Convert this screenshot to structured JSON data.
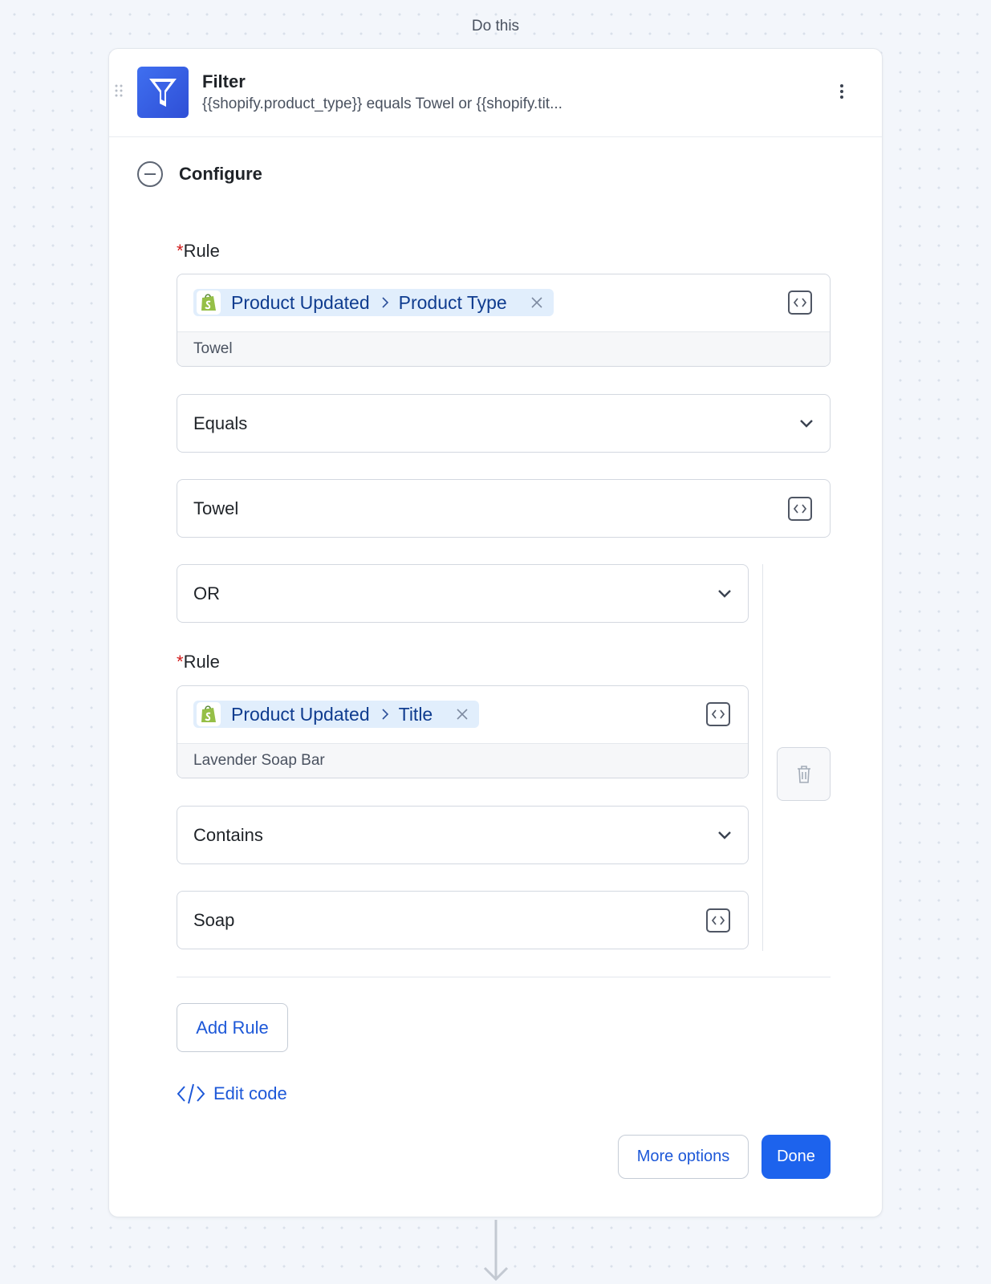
{
  "header": {
    "do_this": "Do this"
  },
  "step": {
    "app_icon": "filter-funnel-icon",
    "title": "Filter",
    "subtitle": "{{shopify.product_type}} equals Towel or {{shopify.tit..."
  },
  "configure": {
    "label": "Configure"
  },
  "rule_label": "Rule",
  "rules": [
    {
      "app": "Product Updated",
      "field": "Product Type",
      "preview": "Towel",
      "operator": "Equals",
      "value": "Towel"
    },
    {
      "app": "Product Updated",
      "field": "Title",
      "preview": "Lavender Soap Bar",
      "operator": "Contains",
      "value": "Soap"
    }
  ],
  "logic": {
    "selected": "OR"
  },
  "actions": {
    "add_rule": "Add Rule",
    "edit_code": "Edit code",
    "more_options": "More options",
    "done": "Done"
  },
  "colors": {
    "accent": "#1d63ed",
    "link": "#1d58d8",
    "token_bg": "#e1eefc",
    "token_text": "#0f3c8f",
    "required": "#d11a1a",
    "app_icon_bg": "#2f4fd6",
    "shopify_green": "#95bf47"
  }
}
